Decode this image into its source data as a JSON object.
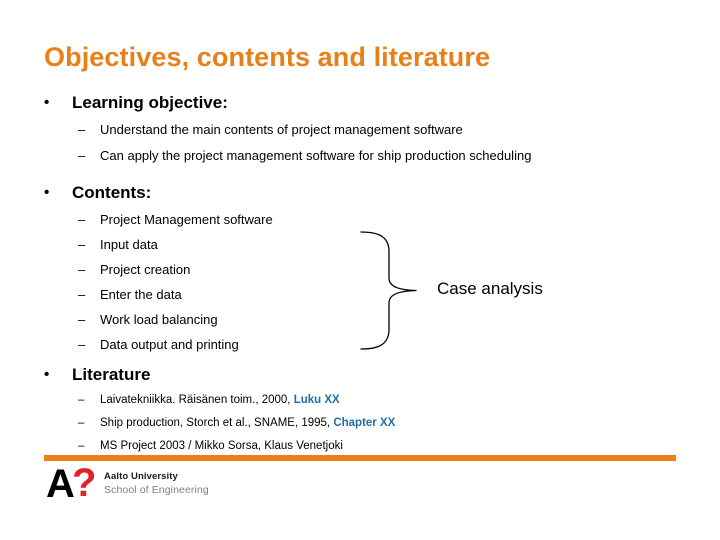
{
  "slide": {
    "title": "Objectives, contents and literature",
    "title_color": "#E8801A"
  },
  "sections": [
    {
      "heading": "Learning objective:",
      "bullet_glyph": "•",
      "items": [
        {
          "dash": "–",
          "text": "Understand the main contents of project management software"
        },
        {
          "dash": "–",
          "text": "Can apply the project management software for ship production scheduling"
        }
      ]
    },
    {
      "heading": "Contents:",
      "bullet_glyph": "•",
      "items": [
        {
          "dash": "–",
          "text": "Project Management software"
        },
        {
          "dash": "–",
          "text": "Input data"
        },
        {
          "dash": "–",
          "text": "Project creation"
        },
        {
          "dash": "–",
          "text": "Enter the data"
        },
        {
          "dash": "–",
          "text": "Work load balancing"
        },
        {
          "dash": "–",
          "text": "Data output and printing"
        }
      ]
    },
    {
      "heading": "Literature",
      "bullet_glyph": "•",
      "items": [
        {
          "dash": "–",
          "text": "Laivatekniikka. Räisänen toim., 2000, ",
          "highlight": "Luku XX"
        },
        {
          "dash": "–",
          "text": "Ship production, Storch et al., SNAME, 1995, ",
          "highlight": "Chapter XX"
        },
        {
          "dash": "–",
          "text": "MS Project 2003 / Mikko Sorsa, Klaus Venetjoki",
          "highlight": ""
        }
      ]
    }
  ],
  "callout": {
    "label": "Case analysis",
    "brace": "right-curly-brace"
  },
  "footer": {
    "rule_color": "#EE7F17",
    "logo": {
      "mark_a": "A",
      "mark_question": "?",
      "mark_question_color": "#E3202A",
      "line1": "Aalto University",
      "line2": "School of Engineering"
    }
  },
  "colors": {
    "title_orange": "#E8801A",
    "highlight_blue": "#1C6FA8",
    "rule_orange": "#EE7F17",
    "logo_red": "#E3202A",
    "text_black": "#000000",
    "logo_gray": "#808080"
  }
}
